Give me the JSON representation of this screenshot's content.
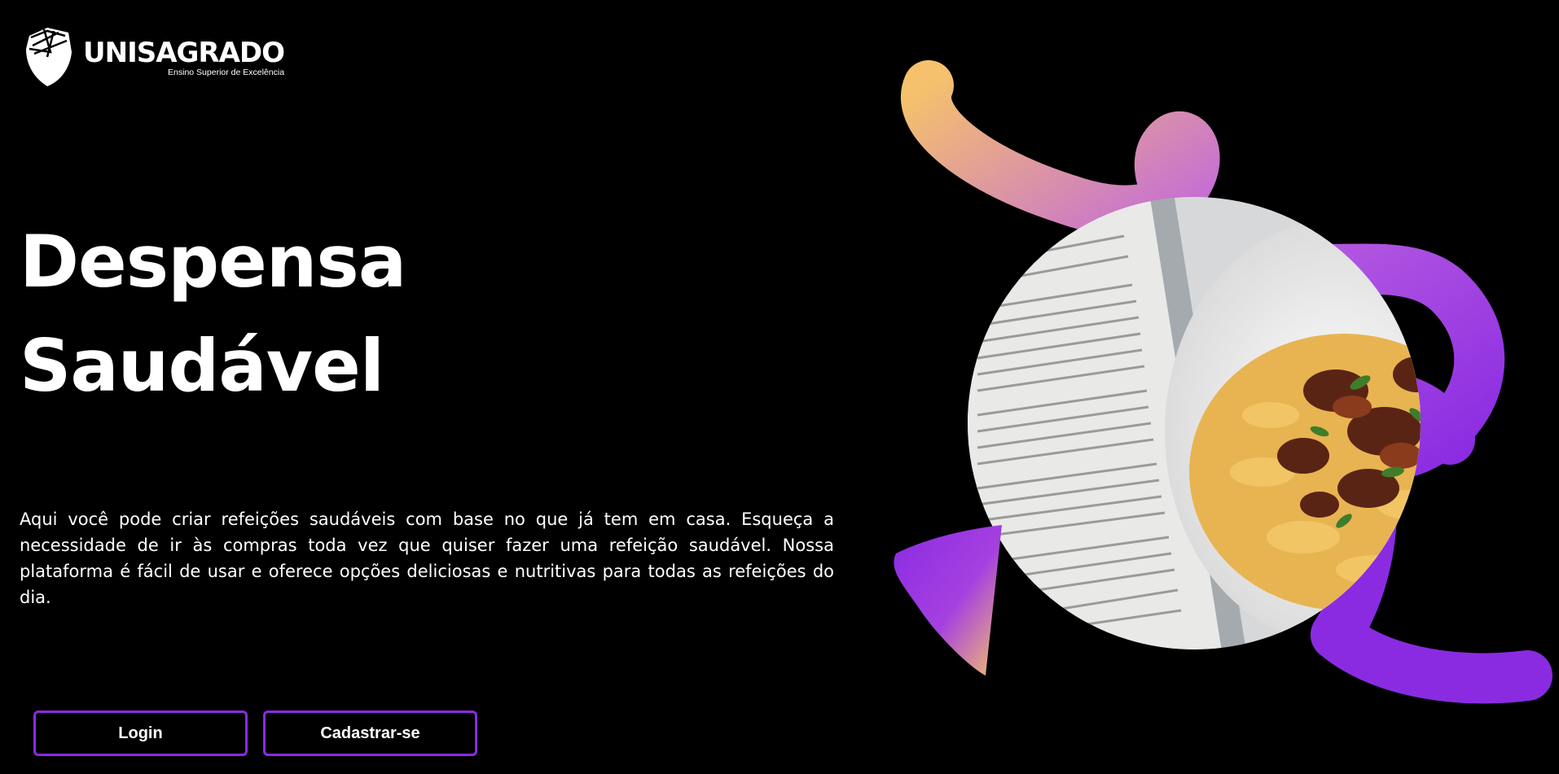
{
  "brand": {
    "name": "UNISAGRADO",
    "tagline": "Ensino Superior de Excelência",
    "logo_icon": "unisagrado-shield-logo"
  },
  "hero": {
    "title_line1": "Despensa",
    "title_line2": "Saudável",
    "description": "Aqui você pode criar refeições saudáveis com base no que já tem em casa. Esqueça a necessidade de ir às compras toda vez que quiser fazer uma refeição saudável. Nossa plataforma é fácil de usar e oferece opções deliciosas e nutritivas para todas as refeições do dia."
  },
  "actions": {
    "login_label": "Login",
    "signup_label": "Cadastrar-se"
  },
  "theme": {
    "background": "#000000",
    "accent": "#8a2be2",
    "gradient_warm": "#f5c16c"
  }
}
